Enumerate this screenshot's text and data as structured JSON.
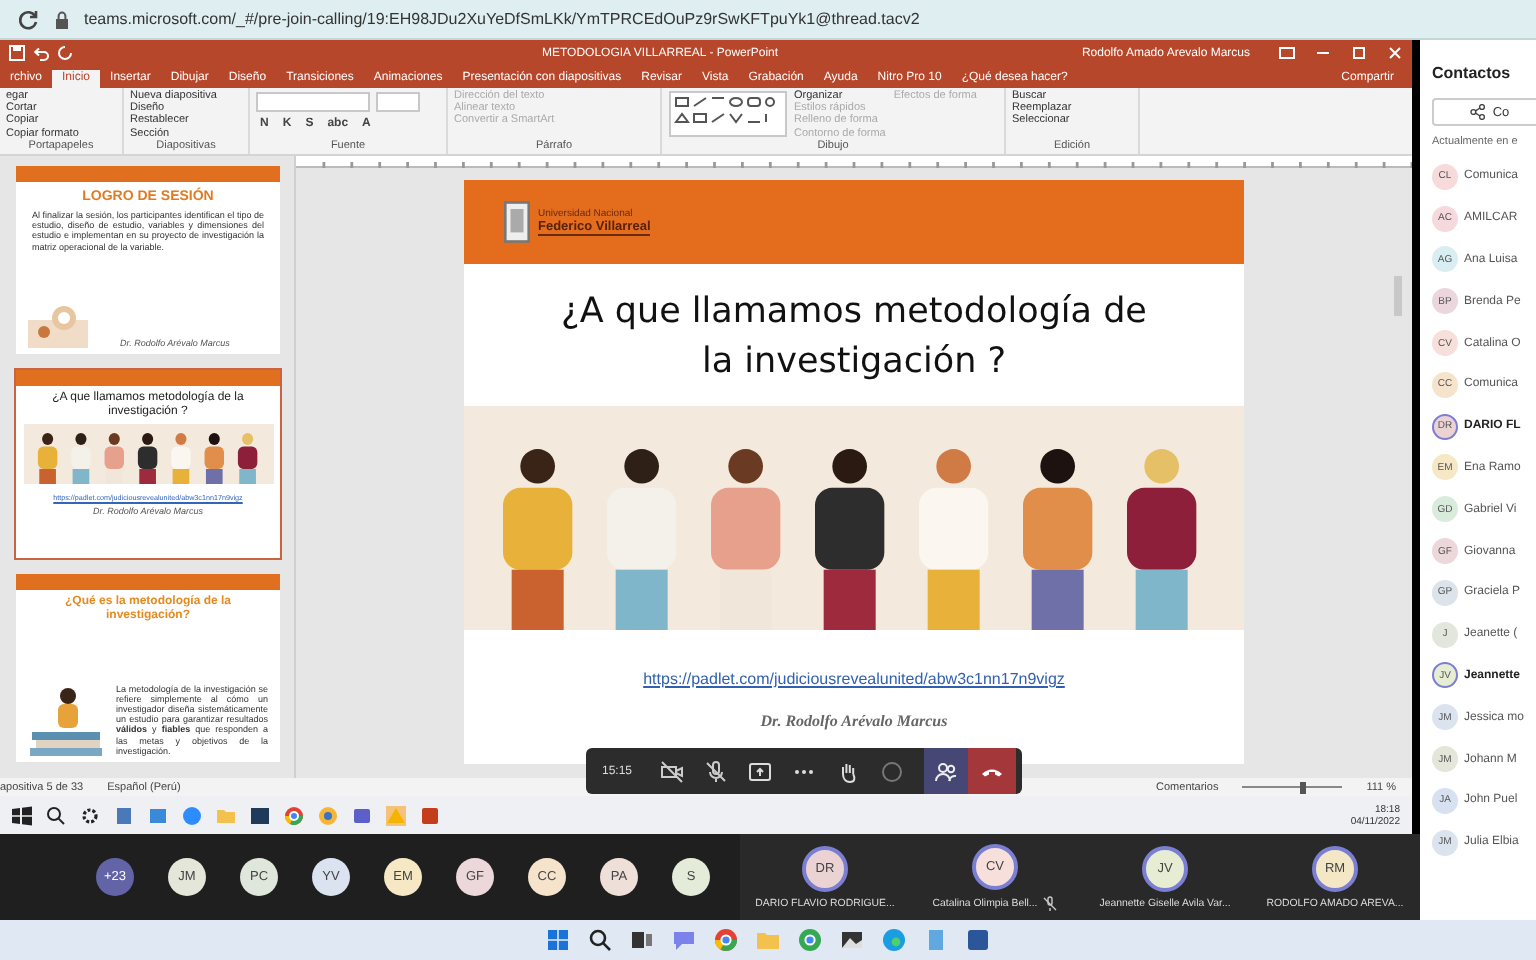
{
  "browser": {
    "url": "teams.microsoft.com/_#/pre-join-calling/19:EH98JDu2XuYeDfSmLKk/YmTPRCEdOuPz9rSwKFTpuYk1@thread.tacv2"
  },
  "powerpoint": {
    "title": "METODOLOGIA VILLARREAL  -  PowerPoint",
    "user": "Rodolfo Amado Arevalo Marcus",
    "share": "Compartir",
    "tell_me": "¿Qué desea hacer?",
    "tabs": [
      {
        "label": "rchivo",
        "selected": false
      },
      {
        "label": "Inicio",
        "selected": true
      },
      {
        "label": "Insertar",
        "selected": false
      },
      {
        "label": "Dibujar",
        "selected": false
      },
      {
        "label": "Diseño",
        "selected": false
      },
      {
        "label": "Transiciones",
        "selected": false
      },
      {
        "label": "Animaciones",
        "selected": false
      },
      {
        "label": "Presentación con diapositivas",
        "selected": false
      },
      {
        "label": "Revisar",
        "selected": false
      },
      {
        "label": "Vista",
        "selected": false
      },
      {
        "label": "Grabación",
        "selected": false
      },
      {
        "label": "Ayuda",
        "selected": false
      },
      {
        "label": "Nitro Pro 10",
        "selected": false
      }
    ],
    "ribbon_groups": [
      {
        "kind": "commands",
        "label": "Portapapeles",
        "commands": [
          {
            "label": "egar",
            "disabled": false
          },
          {
            "label": "Cortar",
            "disabled": false
          },
          {
            "label": "Copiar",
            "disabled": false
          },
          {
            "label": "Copiar formato",
            "disabled": false
          }
        ]
      },
      {
        "kind": "commands",
        "label": "Diapositivas",
        "commands": [
          {
            "label": "Nueva diapositiva",
            "disabled": false
          },
          {
            "label": "Diseño",
            "disabled": false
          },
          {
            "label": "Restablecer",
            "disabled": false
          },
          {
            "label": "Sección",
            "disabled": false
          }
        ]
      },
      {
        "kind": "font",
        "label": "Fuente",
        "commands": [
          {
            "label": "N",
            "disabled": false
          },
          {
            "label": "K",
            "disabled": false
          },
          {
            "label": "S",
            "disabled": false
          },
          {
            "label": "abc",
            "disabled": false
          },
          {
            "label": "A",
            "disabled": false
          }
        ]
      },
      {
        "kind": "commands",
        "label": "Párrafo",
        "commands": [
          {
            "label": "Dirección del texto",
            "disabled": true
          },
          {
            "label": "Alinear texto",
            "disabled": true
          },
          {
            "label": "Convertir a SmartArt",
            "disabled": true
          }
        ]
      },
      {
        "kind": "drawing",
        "label": "Dibujo",
        "commands": [
          {
            "label": "Organizar",
            "disabled": false
          },
          {
            "label": "Estilos rápidos",
            "disabled": true
          },
          {
            "label": "Relleno de forma",
            "disabled": true
          },
          {
            "label": "Contorno de forma",
            "disabled": true
          },
          {
            "label": "Efectos de forma",
            "disabled": true
          }
        ]
      },
      {
        "kind": "commands",
        "label": "Edición",
        "commands": [
          {
            "label": "Buscar",
            "disabled": false
          },
          {
            "label": "Reemplazar",
            "disabled": false
          },
          {
            "label": "Seleccionar",
            "disabled": false
          }
        ]
      }
    ],
    "thumbnails": [
      {
        "kind": "objective",
        "selected": false,
        "title": "LOGRO DE SESIÓN",
        "body": "Al finalizar la sesión, los participantes identifican el tipo de estudio, diseño de estudio, variables y dimensiones del estudio e implementan en su proyecto de investigación la matriz operacional de la variable.",
        "signature": "Dr. Rodolfo Arévalo Marcus"
      },
      {
        "kind": "question",
        "selected": true,
        "title": "¿A que llamamos metodología de la investigación ?",
        "link": "https://padlet.com/judiciousrevealunited/abw3c1nn17n9vigz",
        "signature": "Dr. Rodolfo Arévalo Marcus"
      },
      {
        "kind": "definition",
        "selected": false,
        "title": "¿Qué es la metodología de la investigación?",
        "body": "La metodología de la investigación se refiere simplemente al cómo un investigador diseña sistemáticamente un estudio para garantizar resultados **válidos** y **fiables** que responden a las metas y objetivos de la investigación."
      }
    ],
    "slide": {
      "university_line_1": "Universidad Nacional",
      "university_line_2": "Federico Villarreal",
      "title": "¿A que llamamos metodología de la investigación ?",
      "link": "https://padlet.com/judiciousrevealunited/abw3c1nn17n9vigz",
      "signature": "Dr. Rodolfo Arévalo Marcus"
    },
    "status_bar": {
      "slide_count": "apositiva 5 de 33",
      "language": "Español (Perú)",
      "comments": "Comentarios",
      "zoom": "111 %",
      "zoom_slider": {
        "level": 0.6
      }
    },
    "remote_taskbar": {
      "time": "18:18",
      "date": "04/11/2022"
    }
  },
  "call_toolbar": {
    "duration": "15:15"
  },
  "participants": {
    "overflow": "+23",
    "avatars": [
      {
        "initials": "JM",
        "color": "#e3e6d8"
      },
      {
        "initials": "PC",
        "color": "#dfe6dc"
      },
      {
        "initials": "YV",
        "color": "#dbe3f1"
      },
      {
        "initials": "EM",
        "color": "#f6e8c4"
      },
      {
        "initials": "GF",
        "color": "#ecd7da"
      },
      {
        "initials": "CC",
        "color": "#f6e3cc"
      },
      {
        "initials": "PA",
        "color": "#eee0d8"
      },
      {
        "initials": "S",
        "color": "#e4ecd9"
      }
    ],
    "tiles": [
      {
        "initials": "DR",
        "name": "DARIO FLAVIO RODRIGUE...",
        "color": "#ecd3d3",
        "muted": false
      },
      {
        "initials": "CV",
        "name": "Catalina Olimpia Bell...",
        "color": "#f7dfdb",
        "muted": true
      },
      {
        "initials": "JV",
        "name": "Jeannette Giselle Avila Var...",
        "color": "#e6edd3",
        "muted": false
      },
      {
        "initials": "RM",
        "name": "RODOLFO AMADO AREVA...",
        "color": "#f3e7c6",
        "muted": false
      }
    ]
  },
  "contacts": {
    "title": "Contactos",
    "share": "Co",
    "section": "Actualmente en e",
    "items": [
      {
        "initials": "CL",
        "name": "Comunica",
        "color": "#f7dada",
        "in_call": false
      },
      {
        "initials": "AC",
        "name": "AMILCAR",
        "color": "#f5d9dd",
        "in_call": false
      },
      {
        "initials": "AG",
        "name": "Ana Luisa",
        "color": "#d8eef2",
        "in_call": false
      },
      {
        "initials": "BP",
        "name": "Brenda Pe",
        "color": "#ecd6dd",
        "in_call": false
      },
      {
        "initials": "CV",
        "name": "Catalina O",
        "color": "#f7dfdb",
        "in_call": false
      },
      {
        "initials": "CC",
        "name": "Comunica",
        "color": "#f6e3cc",
        "in_call": false
      },
      {
        "initials": "DR",
        "name": "DARIO FL",
        "color": "#ecd3d3",
        "in_call": true
      },
      {
        "initials": "EM",
        "name": "Ena Ramo",
        "color": "#f6e8c4",
        "in_call": false
      },
      {
        "initials": "GD",
        "name": "Gabriel Vi",
        "color": "#d9ecdc",
        "in_call": false
      },
      {
        "initials": "GF",
        "name": "Giovanna",
        "color": "#ecd7da",
        "in_call": false
      },
      {
        "initials": "GP",
        "name": "Graciela P",
        "color": "#dce3ea",
        "in_call": false
      },
      {
        "initials": "J",
        "name": "Jeanette (",
        "color": "#e3e6dc",
        "in_call": false
      },
      {
        "initials": "JV",
        "name": "Jeannette",
        "color": "#e6edd3",
        "in_call": true
      },
      {
        "initials": "JM",
        "name": "Jessica mo",
        "color": "#dbe3ee",
        "in_call": false
      },
      {
        "initials": "JM",
        "name": "Johann M",
        "color": "#e3e6d8",
        "in_call": false
      },
      {
        "initials": "JA",
        "name": "John Puel",
        "color": "#d7e1f0",
        "in_call": false
      },
      {
        "initials": "JM",
        "name": "Julia Elbia",
        "color": "#dbe3ee",
        "in_call": false
      }
    ]
  }
}
